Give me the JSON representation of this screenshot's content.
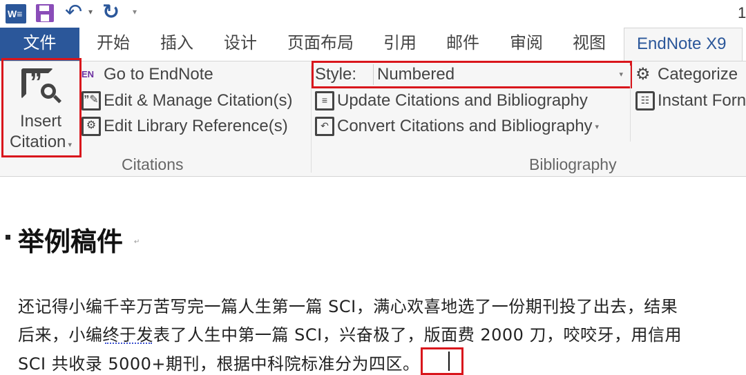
{
  "quick_access": {
    "icons": [
      "word-icon",
      "save-icon",
      "undo-icon",
      "redo-icon",
      "customize-icon"
    ],
    "title_fragment": "1"
  },
  "tabs": [
    {
      "label": "文件"
    },
    {
      "label": "开始"
    },
    {
      "label": "插入"
    },
    {
      "label": "设计"
    },
    {
      "label": "页面布局"
    },
    {
      "label": "引用"
    },
    {
      "label": "邮件"
    },
    {
      "label": "审阅"
    },
    {
      "label": "视图"
    },
    {
      "label": "EndNote X9",
      "active": true
    }
  ],
  "ribbon": {
    "citations": {
      "group_label": "Citations",
      "insert_citation": [
        "Insert",
        "Citation"
      ],
      "go_to": "Go to EndNote",
      "edit_manage": "Edit & Manage Citation(s)",
      "edit_library": "Edit Library Reference(s)",
      "en_badge": "EN"
    },
    "bibliography": {
      "group_label": "Bibliography",
      "style_label": "Style:",
      "style_value": "Numbered",
      "update": "Update Citations and Bibliography",
      "convert": "Convert Citations and Bibliography"
    },
    "tools": {
      "categorize": "Categorize",
      "instant_format": "Instant Forn"
    }
  },
  "document": {
    "heading": "举例稿件",
    "lines": [
      "还记得小编千辛万苦写完一篇人生第一篇 SCI，满心欢喜地选了一份期刊投了出去，结果",
      "后来，小编终于发表了人生中第一篇 SCI，兴奋极了，版面费 2000 刀，咬咬牙，用信用",
      "SCI 共收录 5000+期刊，根据中科院标准分为四区。"
    ]
  },
  "colors": {
    "file_tab": "#2b579a",
    "highlight": "#d9161c",
    "endnote_en": "#6b2fa0"
  }
}
